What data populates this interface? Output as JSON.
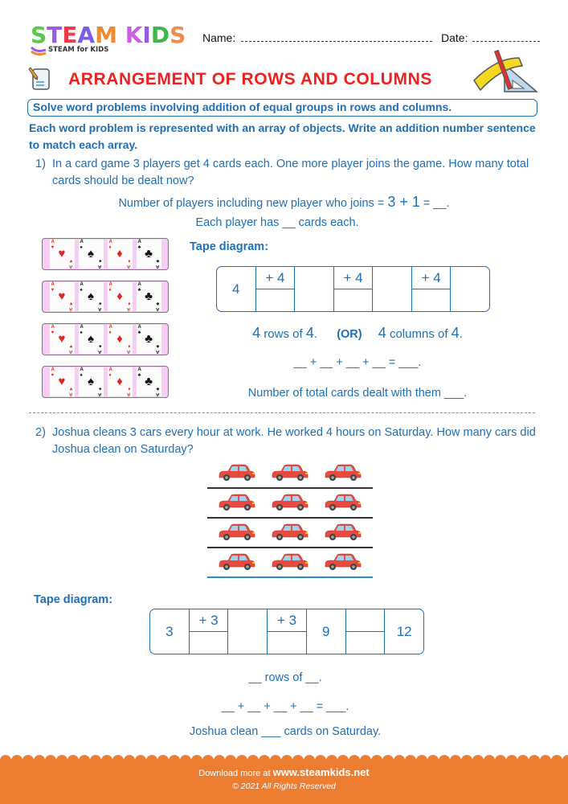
{
  "header": {
    "logo": {
      "letters": [
        {
          "ch": "S",
          "color": "#5cc84a"
        },
        {
          "ch": "T",
          "color": "#9b59e6"
        },
        {
          "ch": "E",
          "color": "#f03a4a"
        },
        {
          "ch": "A",
          "color": "#7b5ce6"
        },
        {
          "ch": "M",
          "color": "#f08a30"
        },
        {
          "ch": " ",
          "color": "#ffffff"
        },
        {
          "ch": "K",
          "color": "#c860e0"
        },
        {
          "ch": "I",
          "color": "#8f5ce6"
        },
        {
          "ch": "D",
          "color": "#3fb84a"
        },
        {
          "ch": "S",
          "color": "#f08a50"
        }
      ],
      "tagline": "STEAM for KIDS"
    },
    "name_label": "Name:",
    "date_label": "Date:"
  },
  "title": "ARRANGEMENT OF ROWS AND COLUMNS",
  "objective": "Solve word problems involving addition of equal groups in rows and columns.",
  "instructions": "Each word problem is represented with an array of objects. Write an addition number sentence to match each array.",
  "colors": {
    "primary_text": "#1f6fb5",
    "title": "#f0201c",
    "footer": "#ec7d31",
    "card_row_bg": "#f8ccf6"
  },
  "problem1": {
    "number": "1)",
    "text": "In a card game 3 players get 4 cards each. One more player joins the game. How many total cards should be dealt now?",
    "players_line_prefix": "Number of players including new player who joins = ",
    "players_line_math": "3 + 1",
    "players_line_suffix": " = __.",
    "each_player_line": "Each player has __ cards each.",
    "card_rows": [
      [
        "hearts",
        "spades",
        "diamonds",
        "clubs"
      ],
      [
        "hearts",
        "spades",
        "diamonds",
        "clubs"
      ],
      [
        "hearts",
        "spades",
        "diamonds",
        "clubs"
      ],
      [
        "hearts",
        "spades",
        "diamonds",
        "clubs"
      ]
    ],
    "card_rank": "A",
    "tape_label": "Tape diagram:",
    "tape": {
      "start": "4",
      "steps": [
        "+ 4",
        "",
        "+ 4",
        "",
        "+ 4",
        ""
      ]
    },
    "rows_line": {
      "rows_num": "4",
      "rows_text": " rows of ",
      "rows_of": "4",
      "or": "(OR)",
      "cols_num": "4",
      "cols_text": " columns of ",
      "cols_of": "4"
    },
    "sum_line": "__ + __ + __ + __ = ___.",
    "total_line": "Number of total cards dealt with them ___."
  },
  "problem2": {
    "number": "2)",
    "text": "Joshua cleans 3 cars every hour at work. He worked 4 hours on Saturday. How many cars did Joshua clean on Saturday?",
    "car_rows": 4,
    "cars_per_row": 3,
    "tape_label": "Tape diagram:",
    "tape": {
      "start": "3",
      "cells": [
        {
          "top": "+ 3",
          "split": true
        },
        {
          "value": "",
          "split": false
        },
        {
          "top": "+ 3",
          "split": true
        },
        {
          "value": "9",
          "split": false
        },
        {
          "top": "",
          "split": true
        },
        {
          "value": "12",
          "split": false
        }
      ]
    },
    "rows_line": "__ rows of __.",
    "sum_line": "__ + __ + __ + __ = ___.",
    "total_line": "Joshua clean ___ cards on Saturday."
  },
  "footer": {
    "download_prefix": "Download more at ",
    "url": "www.steamkids.net",
    "copyright": "© 2021 All Rights Reserved"
  }
}
